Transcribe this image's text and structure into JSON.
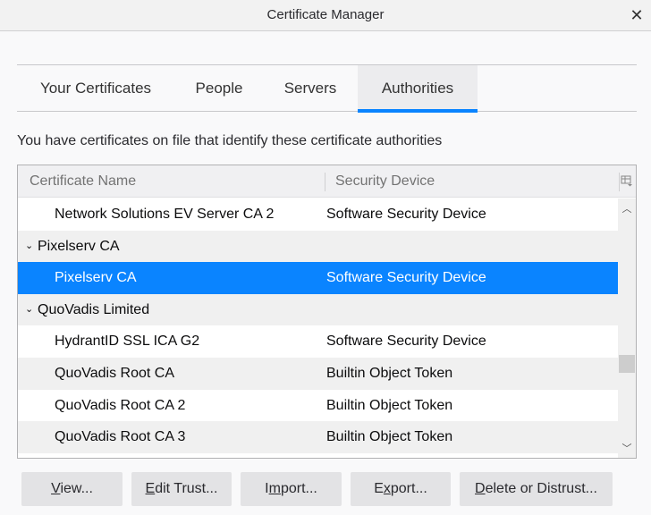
{
  "window": {
    "title": "Certificate Manager",
    "close_glyph": "✕"
  },
  "tabs": [
    {
      "label": "Your Certificates",
      "selected": false
    },
    {
      "label": "People",
      "selected": false
    },
    {
      "label": "Servers",
      "selected": false
    },
    {
      "label": "Authorities",
      "selected": true
    }
  ],
  "description": "You have certificates on file that identify these certificate authorities",
  "table": {
    "columns": [
      "Certificate Name",
      "Security Device"
    ],
    "column_picker_icon": "column-picker-icon",
    "rows": [
      {
        "type": "item",
        "name": "Network Solutions EV Server CA 2",
        "device": "Software Security Device",
        "selected": false
      },
      {
        "type": "group",
        "name": "Pixelserv CA",
        "expanded": true
      },
      {
        "type": "item",
        "name": "Pixelserv CA",
        "device": "Software Security Device",
        "selected": true
      },
      {
        "type": "group",
        "name": "QuoVadis Limited",
        "expanded": true
      },
      {
        "type": "item",
        "name": "HydrantID SSL ICA G2",
        "device": "Software Security Device",
        "selected": false
      },
      {
        "type": "item",
        "name": "QuoVadis Root CA",
        "device": "Builtin Object Token",
        "selected": false
      },
      {
        "type": "item",
        "name": "QuoVadis Root CA 2",
        "device": "Builtin Object Token",
        "selected": false
      },
      {
        "type": "item",
        "name": "QuoVadis Root CA 3",
        "device": "Builtin Object Token",
        "selected": false
      }
    ]
  },
  "buttons": {
    "view": {
      "pre": "",
      "key": "V",
      "post": "iew..."
    },
    "edit_trust": {
      "pre": "",
      "key": "E",
      "post": "dit Trust..."
    },
    "import": {
      "pre": "I",
      "key": "m",
      "post": "port..."
    },
    "export": {
      "pre": "E",
      "key": "x",
      "post": "port..."
    },
    "delete": {
      "pre": "",
      "key": "D",
      "post": "elete or Distrust..."
    }
  },
  "colors": {
    "accent": "#0a84ff",
    "selected_text": "#ffffff"
  }
}
